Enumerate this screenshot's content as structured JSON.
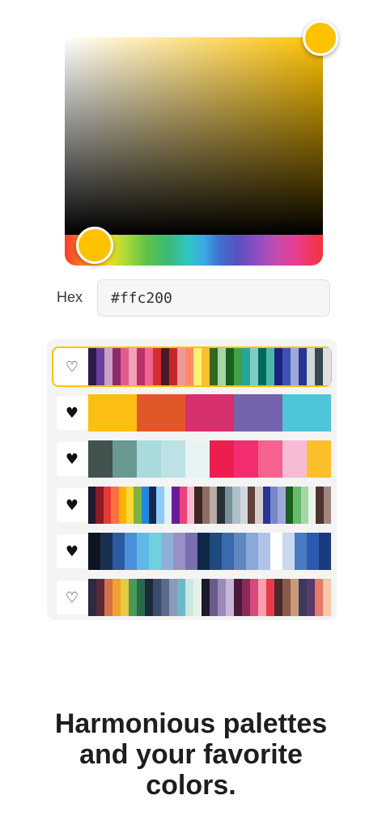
{
  "colors": {
    "accent": "#ffc200",
    "selected_border": "#ffc200"
  },
  "picker": {
    "current_color": "#ffc200"
  },
  "hex": {
    "label": "Hex",
    "value": "#ffc200"
  },
  "palettes": [
    {
      "favorite": false,
      "selected": true,
      "colors": [
        "#2d1b4e",
        "#6b3fa0",
        "#c8a2c8",
        "#8e2a6b",
        "#e05c8a",
        "#f4a3b5",
        "#b8326a",
        "#f06292",
        "#d32f2f",
        "#4a1a2c",
        "#c62828",
        "#ef9a9a",
        "#ff8a65",
        "#fff176",
        "#fbc02d",
        "#33691e",
        "#a5d6a7",
        "#1b5e20",
        "#43a047",
        "#26a69a",
        "#80cbc4",
        "#00695c",
        "#4db6ac",
        "#1a237e",
        "#3f51b5",
        "#9fa8da",
        "#283593",
        "#cfd8dc",
        "#37474f",
        "#e0e0e0"
      ]
    },
    {
      "favorite": true,
      "selected": false,
      "colors": [
        "#fbbf14",
        "#e2572a",
        "#d6306d",
        "#7463ad",
        "#4fc5da"
      ]
    },
    {
      "favorite": true,
      "selected": false,
      "colors": [
        "#42524f",
        "#6a9893",
        "#a9dbdc",
        "#bde2e5",
        "#e8f4f3",
        "#ee1d4f",
        "#f22d70",
        "#f46390",
        "#f8bbd6",
        "#fcbf2c"
      ]
    },
    {
      "favorite": true,
      "selected": false,
      "colors": [
        "#1b1b2e",
        "#8b1a2b",
        "#e53935",
        "#ff7043",
        "#ffb300",
        "#fdd835",
        "#7cb342",
        "#1e88e5",
        "#0d2a4e",
        "#90caf9",
        "#e3f2fd",
        "#6a1b9a",
        "#ec407a",
        "#f8bbd0",
        "#3e2723",
        "#8d6e63",
        "#bcaaa4",
        "#263238",
        "#78909c",
        "#b0bec5",
        "#cfd8dc",
        "#5d4037",
        "#d7ccc8",
        "#283593",
        "#7986cb",
        "#9fa8da",
        "#1b5e20",
        "#66bb6a",
        "#a5d6a7",
        "#e8f5e9",
        "#4e342e",
        "#a1887f"
      ]
    },
    {
      "favorite": true,
      "selected": false,
      "colors": [
        "#0d1520",
        "#1a2f4e",
        "#2c5aa0",
        "#4a90d9",
        "#5fb8e8",
        "#6fd0e0",
        "#8eb0d8",
        "#9a8fc6",
        "#7a6fb0",
        "#0f2848",
        "#1e4a80",
        "#3a6ab0",
        "#5f88c0",
        "#8aa8d8",
        "#b0c4e8",
        "#ffffff",
        "#c8d8f0",
        "#4a7ac0",
        "#2a5ab0",
        "#1a3a80"
      ]
    },
    {
      "favorite": false,
      "selected": false,
      "colors": [
        "#2a2a40",
        "#5a2a3a",
        "#d4704a",
        "#f0a030",
        "#e8c840",
        "#4a9a5a",
        "#2a6a4a",
        "#1a2a3a",
        "#3a4a6a",
        "#5a6a8a",
        "#8a9ab8",
        "#6ab8c8",
        "#c8e8e0",
        "#e8f0e8",
        "#1a1a2a",
        "#6a5a8a",
        "#9a8ab8",
        "#c8b8d8",
        "#4a1a3a",
        "#8a2a5a",
        "#d84a7a",
        "#f8a0b0",
        "#e83a4a",
        "#4a2a2a",
        "#8a5a4a",
        "#c89a7a",
        "#3a3a5a",
        "#5a3a6a",
        "#e87a6a",
        "#f8c8a8"
      ]
    }
  ],
  "tagline": {
    "line1": "Harmonious palettes",
    "line2": "and your favorite",
    "line3": "colors."
  }
}
